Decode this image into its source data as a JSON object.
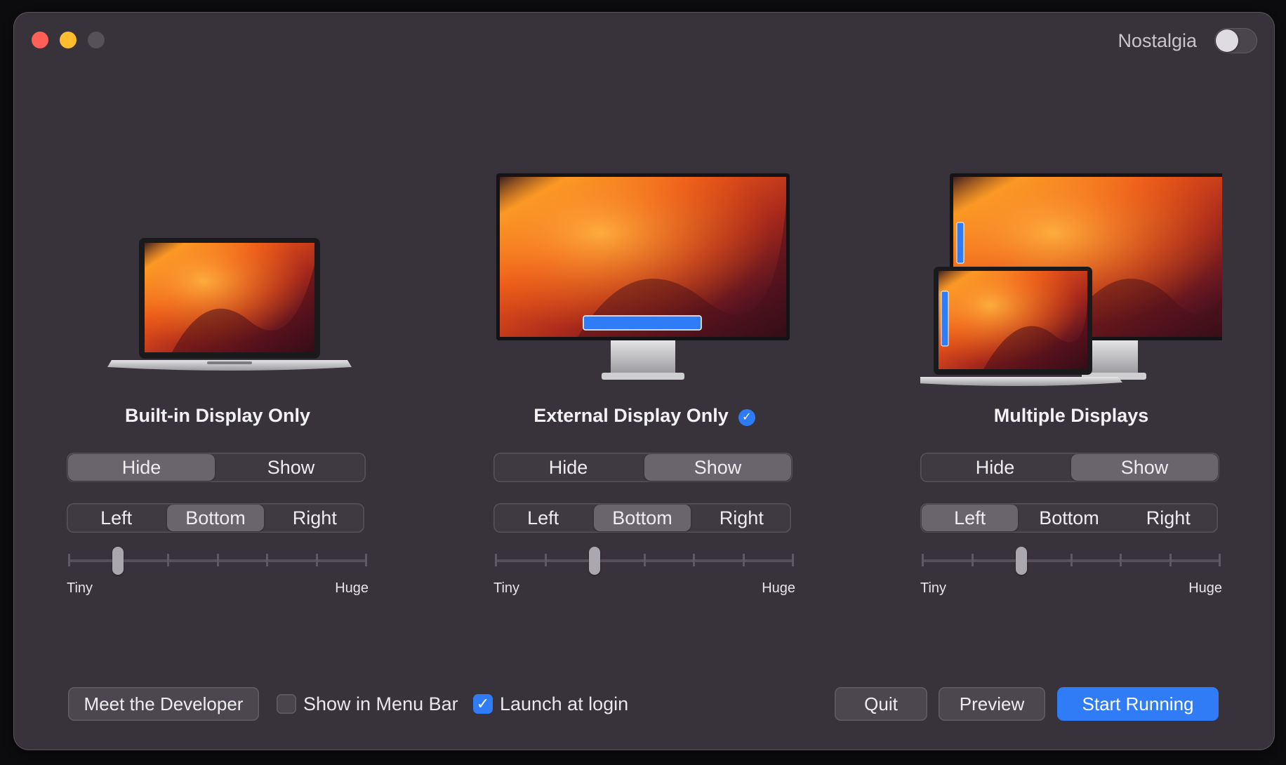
{
  "window": {
    "has_traffic_lights": true
  },
  "header": {
    "nostalgia_label": "Nostalgia",
    "nostalgia_on": false
  },
  "columns": [
    {
      "title": "Built-in Display Only",
      "selected": false,
      "visibility": {
        "options": [
          "Hide",
          "Show"
        ],
        "selected": "Hide"
      },
      "position": {
        "options": [
          "Left",
          "Bottom",
          "Right"
        ],
        "selected": "Bottom"
      },
      "size": {
        "min_label": "Tiny",
        "max_label": "Huge",
        "value": 1,
        "steps": 6
      }
    },
    {
      "title": "External Display Only",
      "selected": true,
      "visibility": {
        "options": [
          "Hide",
          "Show"
        ],
        "selected": "Show"
      },
      "position": {
        "options": [
          "Left",
          "Bottom",
          "Right"
        ],
        "selected": "Bottom"
      },
      "size": {
        "min_label": "Tiny",
        "max_label": "Huge",
        "value": 2,
        "steps": 6
      }
    },
    {
      "title": "Multiple Displays",
      "selected": false,
      "visibility": {
        "options": [
          "Hide",
          "Show"
        ],
        "selected": "Show"
      },
      "position": {
        "options": [
          "Left",
          "Bottom",
          "Right"
        ],
        "selected": "Left"
      },
      "size": {
        "min_label": "Tiny",
        "max_label": "Huge",
        "value": 2,
        "steps": 6
      }
    }
  ],
  "footer": {
    "meet_developer": "Meet the Developer",
    "show_in_menu_bar": {
      "label": "Show in Menu Bar",
      "checked": false
    },
    "launch_at_login": {
      "label": "Launch at login",
      "checked": true
    },
    "quit": "Quit",
    "preview": "Preview",
    "start_running": "Start Running"
  },
  "colors": {
    "accent": "#2f7cf6",
    "window_bg": "#38323a",
    "close": "#fe5f57",
    "minimize": "#febc2e"
  },
  "icons": {
    "badge": "checkmark-circle-icon",
    "check": "checkmark-icon"
  }
}
